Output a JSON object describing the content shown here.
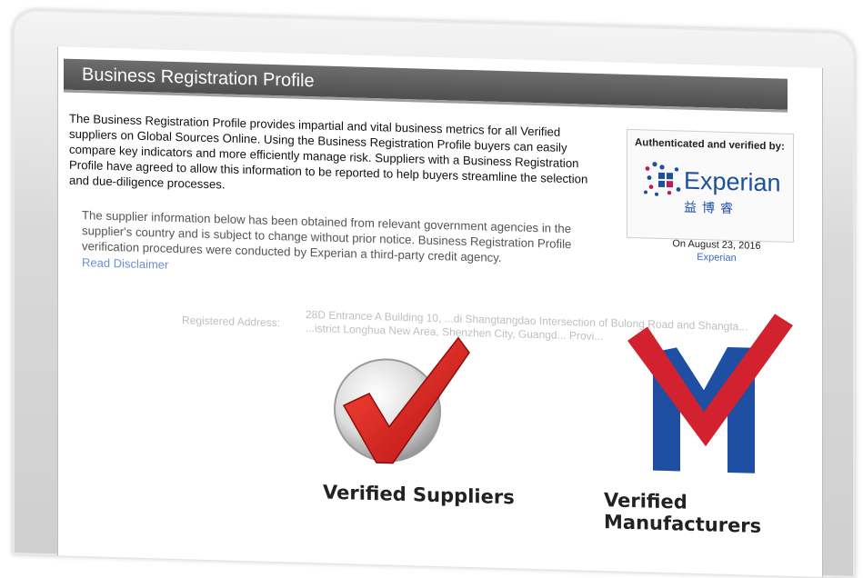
{
  "page": {
    "title": "Business Registration Profile",
    "intro": "The Business Registration Profile provides impartial and vital business metrics for all Verified suppliers on Global Sources Online. Using the Business Registration Profile buyers can easily compare key indicators and more efficiently manage risk. Suppliers with a Business Registration Profile have agreed to allow this information to be reported to help buyers streamline the selection and due-diligence processes.",
    "supplier_info": "The supplier information below has been obtained from relevant government agencies in the supplier's country and is subject to change without prior notice. Business Registration Profile verification procedures were conducted by Experian a third-party credit agency.",
    "disclaimer_link": "Read Disclaimer"
  },
  "verification": {
    "heading": "Authenticated and verified by:",
    "brand": "Experian",
    "brand_chinese": "益博睿",
    "date": "On August 23, 2016",
    "link": "Experian"
  },
  "address": {
    "label": "Registered Address:",
    "value": "28D Entrance A Building 10, ...di Shangtangdao Intersection of Bulong Road and Shangta... ...istrict Longhua New Area, Shenzhen City, Guangd... Provi..."
  },
  "badges": {
    "suppliers": "Verified Suppliers",
    "manufacturers": "Verified Manufacturers"
  },
  "colors": {
    "title_bar": "#555555",
    "experian_blue": "#1d4f9f",
    "experian_pink": "#c2185b",
    "check_red": "#d21f1f",
    "m_blue": "#1f4fa3",
    "link": "#6b8ed6"
  }
}
